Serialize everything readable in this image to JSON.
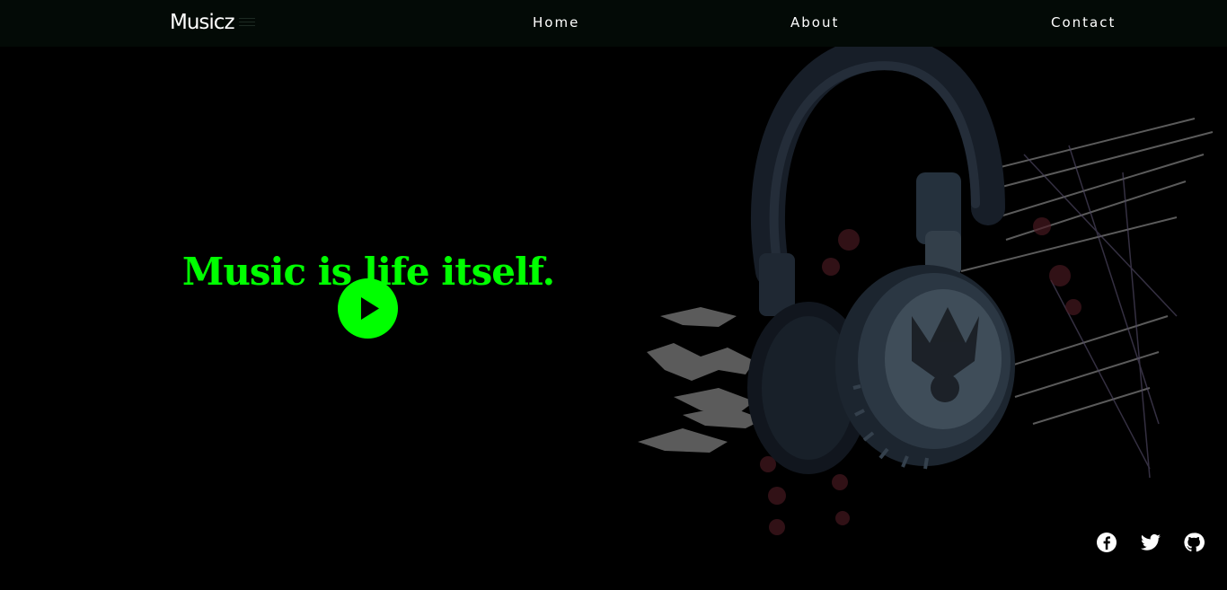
{
  "navbar": {
    "brand": "Musicz",
    "links": {
      "home": "Home",
      "about": "About",
      "contact": "Contact"
    }
  },
  "hero": {
    "title": "Music is life itself.",
    "play_icon": "play-icon",
    "illustration": "headphones-illustration"
  },
  "social": {
    "icons": [
      "facebook-icon",
      "twitter-icon",
      "github-icon"
    ]
  },
  "colors": {
    "accent": "#00ff00",
    "background": "#000000",
    "navbar": "#030a06",
    "text": "#ffffff"
  }
}
